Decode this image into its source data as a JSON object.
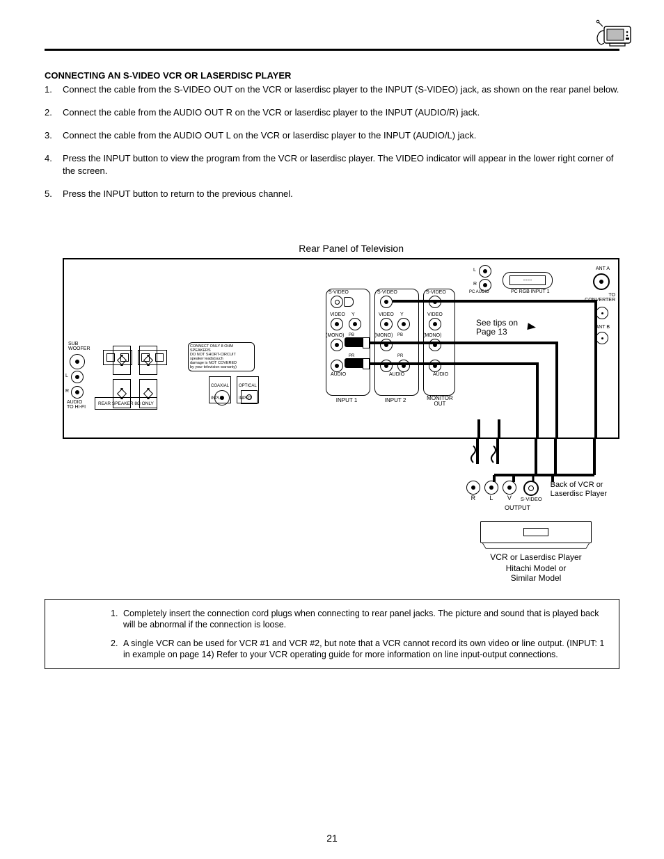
{
  "heading": "CONNECTING AN S-VIDEO VCR OR LASERDISC PLAYER",
  "steps": [
    {
      "num": "1.",
      "text": "Connect the cable from the S-VIDEO OUT on the VCR or laserdisc player to the INPUT (S-VIDEO) jack, as shown on the rear panel below."
    },
    {
      "num": "2.",
      "text": "Connect the cable from the AUDIO OUT R on the VCR or laserdisc player to the INPUT (AUDIO/R) jack."
    },
    {
      "num": "3.",
      "text": "Connect the cable from the AUDIO OUT L on the VCR or laserdisc player to the INPUT (AUDIO/L) jack."
    },
    {
      "num": "4.",
      "text": "Press the INPUT button to view the program from the VCR or laserdisc player.  The VIDEO indicator will appear in the lower right corner of the screen."
    },
    {
      "num": "5.",
      "text": "Press the INPUT button to return to the previous channel."
    }
  ],
  "diagram": {
    "title": "Rear Panel of Television",
    "see_tips": "See tips on\nPage 13",
    "labels": {
      "ant_a": "ANT A",
      "to_conv": "TO\nCONVERTER",
      "ant_b": "ANT B",
      "pc_audio": "PC AUDIO",
      "pc_rgb": "PC RGB INPUT 1",
      "svideo": "S-VIDEO",
      "video": "VIDEO",
      "y": "Y",
      "pb": "PB",
      "pr": "PR",
      "mono": "(MONO)",
      "audio": "AUDIO",
      "input1": "INPUT 1",
      "input2": "INPUT 2",
      "monitor_out": "MONITOR\nOUT",
      "sub_woofer": "SUB\nWOOFER",
      "l": "L",
      "r": "R",
      "audio_to_hifi": "AUDIO\nTO HI-FI",
      "rear_spk": "REAR SPEAKER 8Ω ONLY",
      "coax": "COAXIAL\nINPUT",
      "opt": "OPTICAL\nINPUT",
      "spk_warn": "CONNECT ONLY 8 OHM SPEAKERS\nDO NOT SHORT-CIRCUIT\nspeaker leads(such\ndamage is NOT COVERED\nby your television warranty)"
    }
  },
  "back_vcr": {
    "label": "Back of VCR or\nLaserdisc Player",
    "r": "R",
    "l": "L",
    "v": "V",
    "svideo": "S-VIDEO",
    "output": "OUTPUT"
  },
  "vcr_caption1": "VCR or Laserdisc Player",
  "vcr_caption2": "Hitachi Model or\nSimilar Model",
  "notes": [
    {
      "num": "1.",
      "text": "Completely insert the connection cord plugs when connecting to rear panel jacks.  The picture and sound that is played back will be abnormal if the connection is loose."
    },
    {
      "num": "2.",
      "text": "A single VCR can be used for VCR #1 and VCR #2, but note that a VCR cannot record its own video or line output. (INPUT: 1 in example on page 14)  Refer to your VCR operating guide for more information on line input-output connections."
    }
  ],
  "page_number": "21"
}
